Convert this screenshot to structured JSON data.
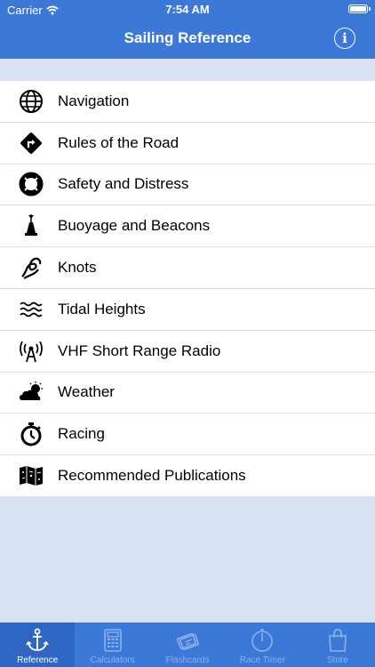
{
  "status_bar": {
    "carrier": "Carrier",
    "time": "7:54 AM"
  },
  "nav": {
    "title": "Sailing Reference",
    "info_icon": "info-icon"
  },
  "colors": {
    "bar": "#3c78d8",
    "background": "#d9e2f3",
    "active_tab": "#2f66c4",
    "inactive_tab_text": "#8fb1e8"
  },
  "list": {
    "items": [
      {
        "label": "Navigation",
        "icon": "globe-icon"
      },
      {
        "label": "Rules of the Road",
        "icon": "road-sign-icon"
      },
      {
        "label": "Safety and Distress",
        "icon": "lifebuoy-icon"
      },
      {
        "label": "Buoyage and Beacons",
        "icon": "buoy-icon"
      },
      {
        "label": "Knots",
        "icon": "knot-icon"
      },
      {
        "label": "Tidal Heights",
        "icon": "waves-icon"
      },
      {
        "label": "VHF Short Range Radio",
        "icon": "antenna-icon"
      },
      {
        "label": "Weather",
        "icon": "cloud-sun-icon"
      },
      {
        "label": "Racing",
        "icon": "stopwatch-icon"
      },
      {
        "label": "Recommended Publications",
        "icon": "map-icon"
      }
    ]
  },
  "tabs": [
    {
      "label": "Reference",
      "icon": "anchor-icon",
      "active": true
    },
    {
      "label": "Calculators",
      "icon": "calculator-icon",
      "active": false
    },
    {
      "label": "Flashcards",
      "icon": "flashcards-icon",
      "active": false
    },
    {
      "label": "Race Timer",
      "icon": "timer-icon",
      "active": false
    },
    {
      "label": "Store",
      "icon": "bag-icon",
      "active": false
    }
  ]
}
